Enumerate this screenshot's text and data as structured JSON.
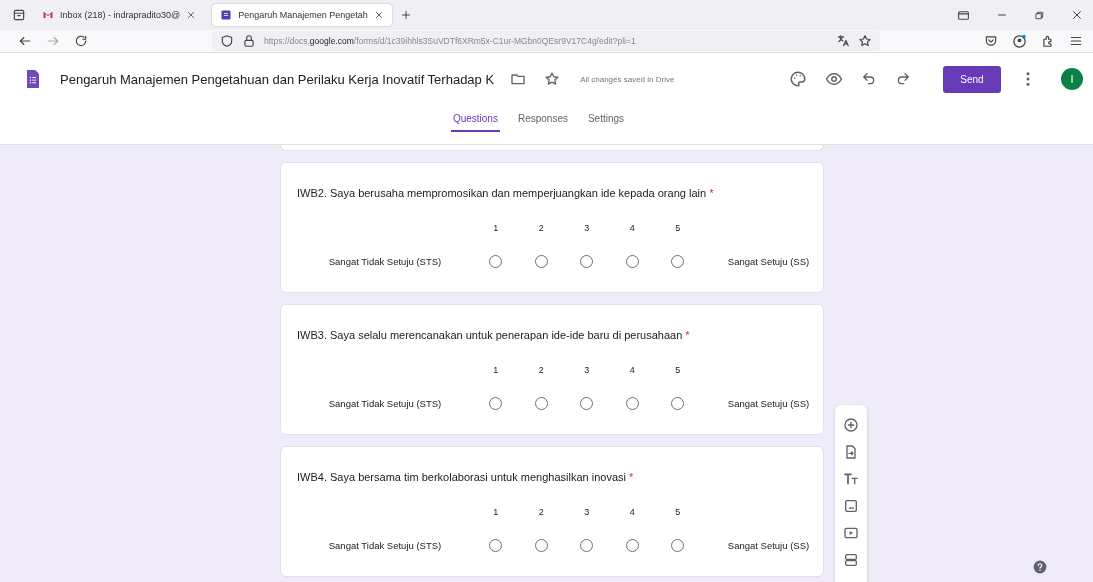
{
  "browser_tabs": [
    {
      "kind": "gmail",
      "label": "Inbox (218) - indrapradito30@",
      "selected": false
    },
    {
      "kind": "forms",
      "label": "Pengaruh Manajemen Pengetah",
      "selected": true
    }
  ],
  "address_bar": {
    "url_prefix": "https://docs.",
    "url_domain": "google.com",
    "url_rest": "/forms/d/1c39ihhls3SuVDTf6XRm5x-C1ur-MGbn0QEsr9V17C4g/edit?pli=1"
  },
  "form_header": {
    "title": "Pengaruh Manajemen Pengetahuan dan Perilaku Kerja Inovatif Terhadap K",
    "save_status": "All changes saved in Drive",
    "send_label": "Send",
    "avatar_letter": "I"
  },
  "form_tabs": [
    {
      "label": "Questions",
      "selected": true
    },
    {
      "label": "Responses",
      "selected": false
    },
    {
      "label": "Settings",
      "selected": false
    }
  ],
  "questions": [
    {
      "text": "IWB2. Saya berusaha mempromosikan dan memperjuangkan ide kepada orang lain",
      "required_mark": "*",
      "low_label": "Sangat Tidak Setuju (STS)",
      "high_label": "Sangat Setuju (SS)",
      "options": [
        {
          "label": "1",
          "selected": false
        },
        {
          "label": "2",
          "selected": false
        },
        {
          "label": "3",
          "selected": false
        },
        {
          "label": "4",
          "selected": false
        },
        {
          "label": "5",
          "selected": false
        }
      ]
    },
    {
      "text": "IWB3. Saya selalu merencanakan untuk penerapan ide-ide baru di perusahaan",
      "required_mark": "*",
      "low_label": "Sangat Tidak Setuju (STS)",
      "high_label": "Sangat Setuju (SS)",
      "options": [
        {
          "label": "1",
          "selected": false
        },
        {
          "label": "2",
          "selected": false
        },
        {
          "label": "3",
          "selected": false
        },
        {
          "label": "4",
          "selected": false
        },
        {
          "label": "5",
          "selected": false
        }
      ]
    },
    {
      "text": "IWB4. Saya bersama tim berkolaborasi untuk menghasilkan inovasi",
      "required_mark": "*",
      "low_label": "Sangat Tidak Setuju (STS)",
      "high_label": "Sangat Setuju (SS)",
      "options": [
        {
          "label": "1",
          "selected": false
        },
        {
          "label": "2",
          "selected": false
        },
        {
          "label": "3",
          "selected": false
        },
        {
          "label": "4",
          "selected": false
        },
        {
          "label": "5",
          "selected": false
        }
      ]
    }
  ]
}
